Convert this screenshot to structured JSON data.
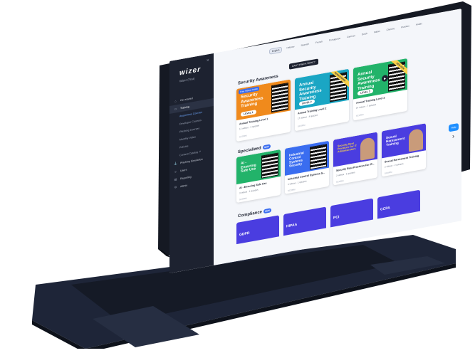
{
  "sidebar": {
    "logo": "wizer",
    "org": "Wizer (Test)",
    "items": [
      {
        "label": "Get started",
        "icon": "home-icon"
      },
      {
        "label": "Training",
        "icon": "monitor-icon"
      },
      {
        "label": "Awareness Courses",
        "sub": true
      },
      {
        "label": "Developer Courses",
        "sub": true
      },
      {
        "label": "Phishing Courses",
        "sub": true
      },
      {
        "label": "Monthly Video",
        "sub": true
      },
      {
        "label": "Policies",
        "sub": true
      },
      {
        "label": "Content Catalog",
        "sub": true
      },
      {
        "label": "Phishing Simulation",
        "icon": "hook-icon"
      },
      {
        "label": "Users",
        "icon": "users-icon"
      },
      {
        "label": "Reporting",
        "icon": "chart-icon"
      },
      {
        "label": "Admin",
        "icon": "gear-icon"
      }
    ]
  },
  "languages": [
    "English",
    "Hebrew",
    "Spanish",
    "French",
    "Portuguese",
    "German",
    "Dutch",
    "Italian",
    "Chinese",
    "Russian",
    "Arabic"
  ],
  "tooltip": "CAN'T FIND A TOPIC?",
  "sections": {
    "security": "Security Awareness",
    "specialized": "Specialized",
    "compliance": "Compliance",
    "new_badge": "NEW"
  },
  "security_cards": [
    {
      "thumb": "Security Awareness Training",
      "level": "LEVEL 1",
      "tag": "Free Videos Inside",
      "title": "Annual Training Level 1",
      "meta": "12 videos · 3 quizzes",
      "foot": "SCORM"
    },
    {
      "thumb": "Annual Security Awareness Training",
      "level": "LEVEL 2",
      "ribbon": "REMASTERED",
      "title": "Annual Training Level 2",
      "meta": "17 videos · 4 quizzes",
      "foot": "SCORM"
    },
    {
      "thumb": "Annual Security Awareness Training",
      "level": "LEVEL 3",
      "ribbon": "NEW 2024",
      "title": "Annual Training Level 3",
      "meta": "14 videos · 7 quizzes",
      "foot": "SCORM"
    }
  ],
  "specialized_cards": [
    {
      "thumb": "AI - Ensuring Safe Use",
      "title": "AI - Ensuring Safe Use",
      "meta": "3 videos · 1 quizzes",
      "foot": "SCORM"
    },
    {
      "thumb": "Industrial Control Systems Security",
      "title": "Industrial Control Systems S...",
      "meta": "3 videos · 1 quizzes",
      "foot": "SCORM"
    },
    {
      "thumb": "Security Best Practices For IT Administrators",
      "title": "Security Best Practices For IT...",
      "meta": "2 videos · 1 quizzes",
      "foot": "SCORM"
    },
    {
      "thumb": "Sexual Harassment Training",
      "title": "Sexual Harassment Training",
      "meta": "2 videos · 2 quizzes",
      "foot": "SCORM"
    }
  ],
  "compliance_cards": [
    "GDPR",
    "HIPAA",
    "PCI",
    "CCPA"
  ],
  "help": "Help",
  "colors": {
    "orange": "#f08a1c",
    "teal": "#1aa6c4",
    "green": "#22b36a",
    "blue": "#3a6df0",
    "purple": "#4a3de0",
    "navy": "#1d2230"
  }
}
